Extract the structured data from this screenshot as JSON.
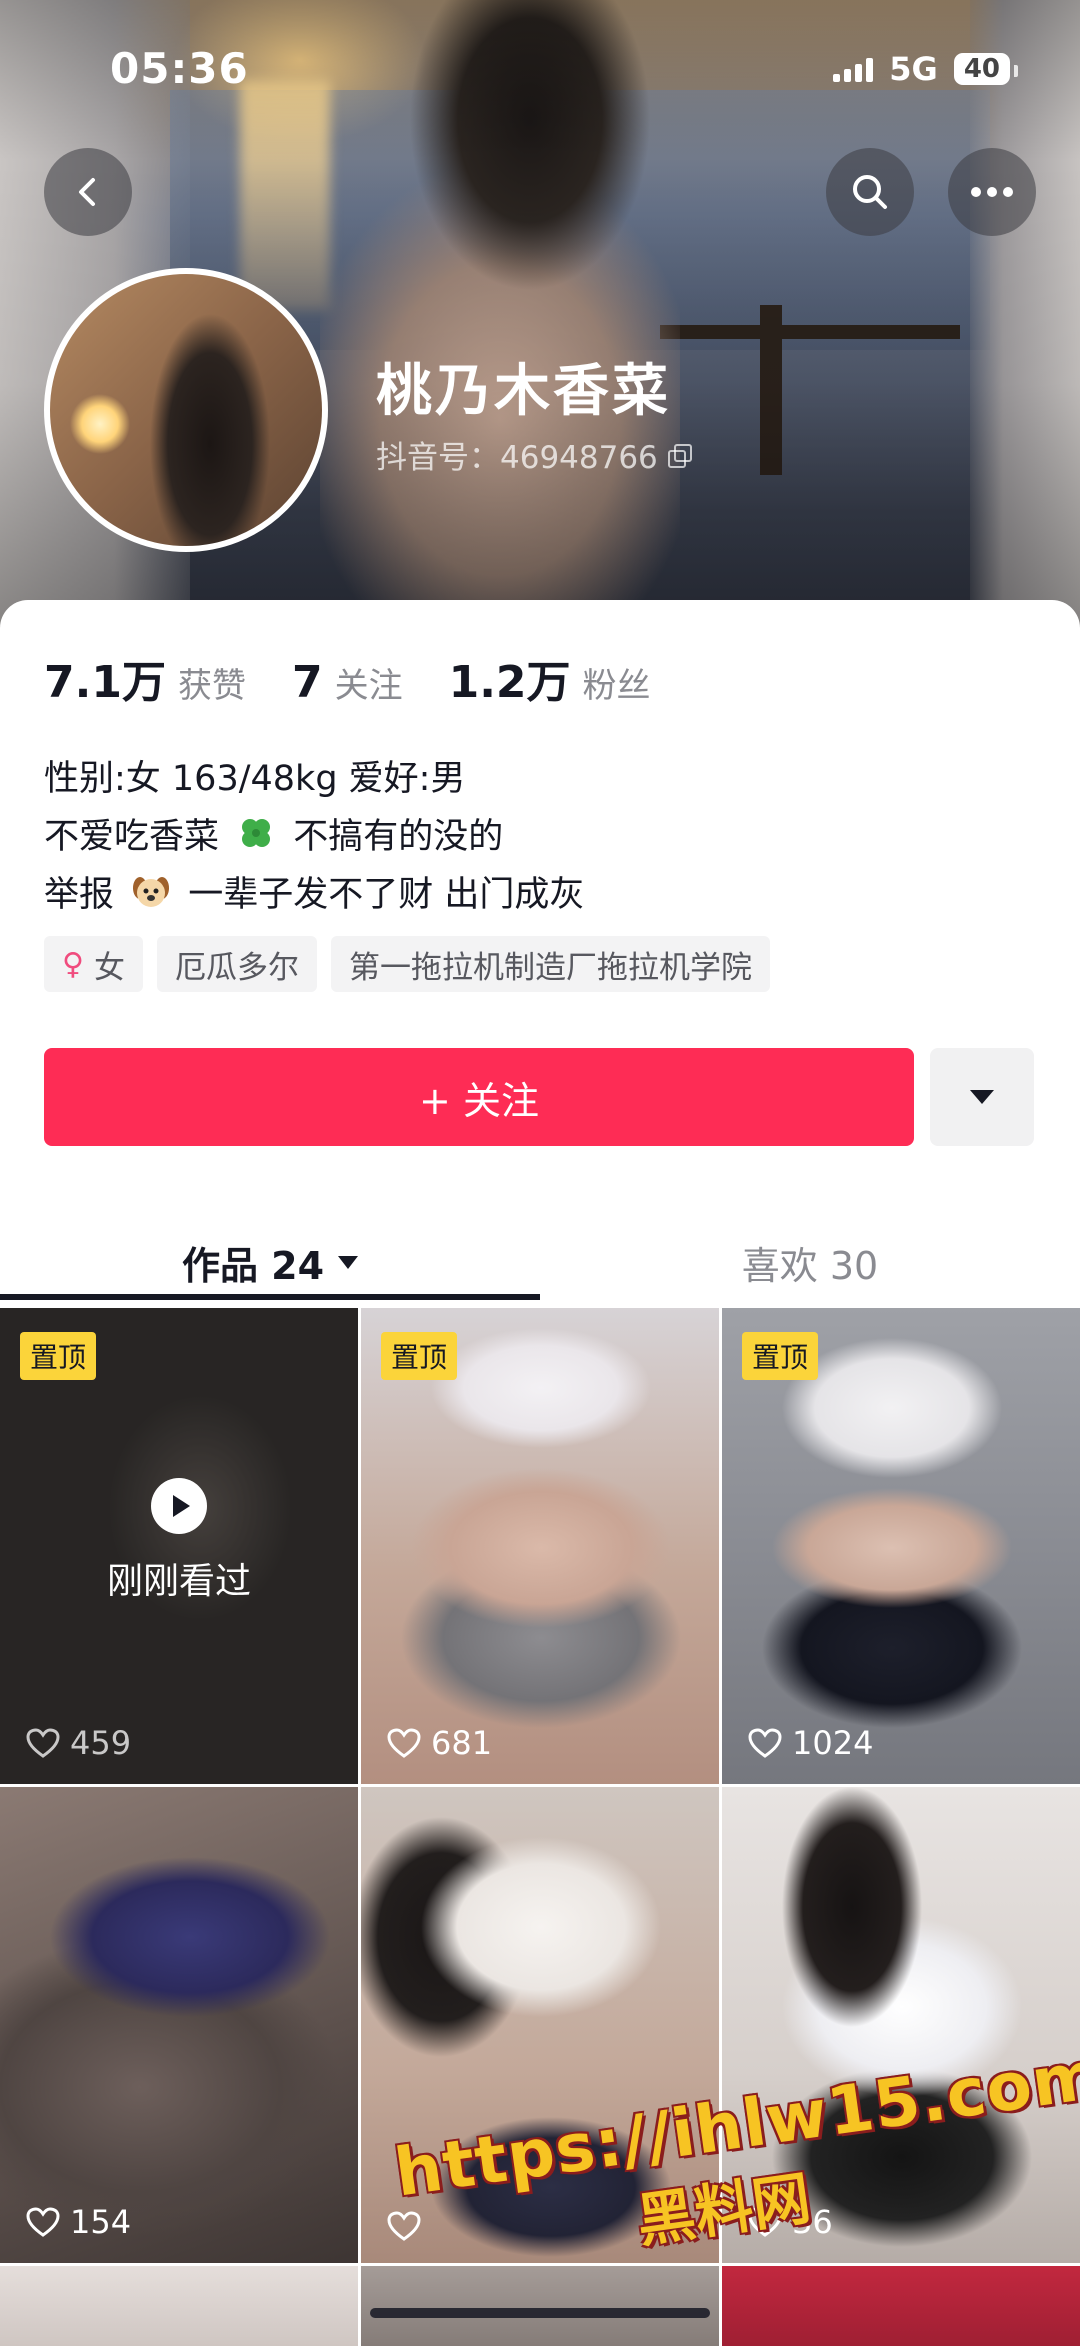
{
  "status_bar": {
    "time": "05:36",
    "network": "5G",
    "battery": "40"
  },
  "profile": {
    "nickname": "桃乃木香菜",
    "douyin_id": "抖音号：46948766"
  },
  "stats": [
    {
      "value": "7.1万",
      "label": "获赞"
    },
    {
      "value": "7",
      "label": "关注"
    },
    {
      "value": "1.2万",
      "label": "粉丝"
    }
  ],
  "bio": {
    "line1": "性别:女  163/48kg  爱好:男",
    "line2a": "不爱吃香菜",
    "line2b": "不搞有的没的",
    "line3a": "举报",
    "line3b": "一辈子发不了财 出门成灰"
  },
  "tags": {
    "gender": "女",
    "location": "厄瓜多尔",
    "school": "第一拖拉机制造厂拖拉机学院"
  },
  "actions": {
    "follow": "+ 关注"
  },
  "tabs": {
    "works": "作品 24",
    "likes": "喜欢 30"
  },
  "videos": [
    {
      "likes": "459",
      "pinned": "置顶",
      "overlay": "刚刚看过"
    },
    {
      "likes": "681",
      "pinned": "置顶"
    },
    {
      "likes": "1024",
      "pinned": "置顶"
    },
    {
      "likes": "154"
    },
    {
      "likes": ""
    },
    {
      "likes": "36"
    }
  ],
  "watermark": {
    "url": "https://ihlw15.com",
    "name": "黑料网"
  },
  "colors": {
    "accent": "#fe2c55",
    "pin": "#fbd43a",
    "text": "#161823",
    "muted": "#8a8b91"
  },
  "icons": [
    "back-icon",
    "search-icon",
    "more-icon",
    "copy-icon",
    "venus-icon",
    "dropdown-icon",
    "play-icon",
    "heart-icon"
  ]
}
